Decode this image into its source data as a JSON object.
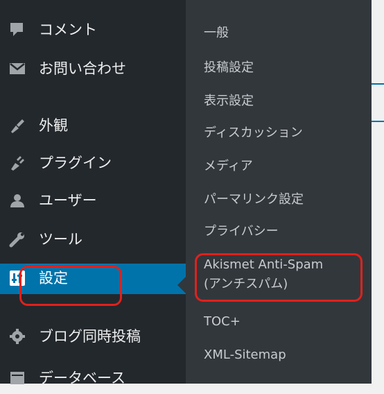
{
  "admin_menu": {
    "items": [
      {
        "label": "コメント",
        "icon": "comment-icon"
      },
      {
        "label": "お問い合わせ",
        "icon": "mail-icon"
      },
      {
        "label": "外観",
        "icon": "paintbrush-icon"
      },
      {
        "label": "プラグイン",
        "icon": "plugin-icon"
      },
      {
        "label": "ユーザー",
        "icon": "user-icon"
      },
      {
        "label": "ツール",
        "icon": "wrench-icon"
      },
      {
        "label": "設定",
        "icon": "settings-icon"
      },
      {
        "label": "ブログ同時投稿",
        "icon": "gear-icon"
      },
      {
        "label": "データベース",
        "icon": "database-icon"
      }
    ],
    "current": "設定"
  },
  "submenu": {
    "items": [
      "一般",
      "投稿設定",
      "表示設定",
      "ディスカッション",
      "メディア",
      "パーマリンク設定",
      "プライバシー",
      "Akismet Anti-Spam",
      "(アンチスパム)",
      "TOC+",
      "XML-Sitemap"
    ]
  },
  "colors": {
    "menu_bg": "#23282d",
    "submenu_bg": "#32373c",
    "active_bg": "#0073aa",
    "highlight_red": "#e0211c"
  }
}
